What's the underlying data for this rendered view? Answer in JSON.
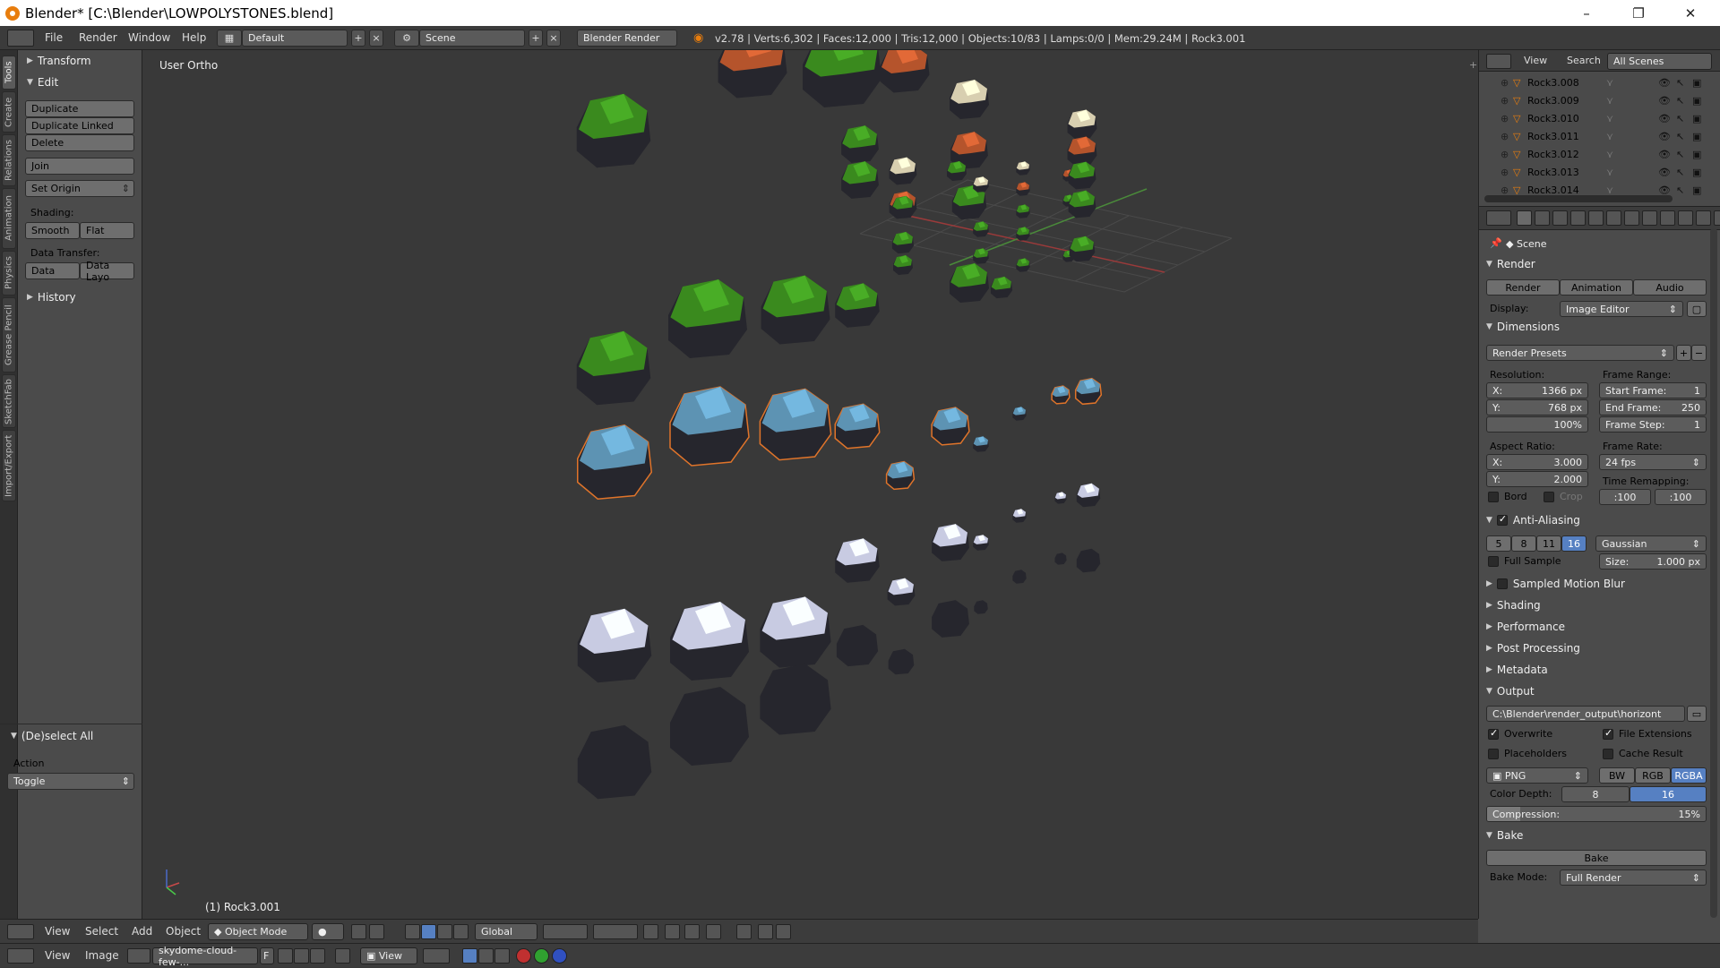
{
  "window": {
    "title": "Blender* [C:\\Blender\\LOWPOLYSTONES.blend]",
    "minimize": "–",
    "maximize": "❐",
    "close": "✕"
  },
  "info_bar": {
    "menus": [
      "File",
      "Render",
      "Window",
      "Help"
    ],
    "layout": "Default",
    "scene": "Scene",
    "engine": "Blender Render",
    "stats": "v2.78 | Verts:6,302 | Faces:12,000 | Tris:12,000 | Objects:10/83 | Lamps:0/0 | Mem:29.24M | Rock3.001"
  },
  "left_tabs": [
    "Tools",
    "Create",
    "Relations",
    "Animation",
    "Physics",
    "Grease Pencil",
    "SketchFab",
    "Import/Export"
  ],
  "tool_shelf": {
    "transform": "Transform",
    "edit": "Edit",
    "duplicate": "Duplicate",
    "duplicate_linked": "Duplicate Linked",
    "delete": "Delete",
    "join": "Join",
    "set_origin": "Set Origin",
    "shading_label": "Shading:",
    "smooth": "Smooth",
    "flat": "Flat",
    "data_transfer_label": "Data Transfer:",
    "data": "Data",
    "data_layo": "Data Layo",
    "history": "History",
    "deselect_all": "(De)select All",
    "action_label": "Action",
    "action_value": "Toggle"
  },
  "viewport": {
    "view_name": "User Ortho",
    "selected_object": "(1) Rock3.001",
    "axis_x": "x",
    "axis_y": "y",
    "axis_z": "z"
  },
  "outliner": {
    "view": "View",
    "search": "Search",
    "filter": "All Scenes",
    "rows": [
      "Rock3.008",
      "Rock3.009",
      "Rock3.010",
      "Rock3.011",
      "Rock3.012",
      "Rock3.013",
      "Rock3.014"
    ]
  },
  "properties": {
    "scene": "Scene",
    "render_section": "Render",
    "render_btn": "Render",
    "animation_btn": "Animation",
    "audio_btn": "Audio",
    "display_label": "Display:",
    "display_value": "Image Editor",
    "dimensions_section": "Dimensions",
    "render_presets": "Render Presets",
    "resolution_label": "Resolution:",
    "res_x_label": "X:",
    "res_x": "1366 px",
    "res_y_label": "Y:",
    "res_y": "768 px",
    "res_pct": "100%",
    "frame_range_label": "Frame Range:",
    "start_frame_label": "Start Frame:",
    "start_frame": "1",
    "end_frame_label": "End Frame:",
    "end_frame": "250",
    "frame_step_label": "Frame Step:",
    "frame_step": "1",
    "aspect_label": "Aspect Ratio:",
    "aspect_x_label": "X:",
    "aspect_x": "3.000",
    "aspect_y_label": "Y:",
    "aspect_y": "2.000",
    "frame_rate_label": "Frame Rate:",
    "frame_rate": "24 fps",
    "time_remap_label": "Time Remapping:",
    "remap_old": ":100",
    "remap_new": ":100",
    "bord": "Bord",
    "crop": "Crop",
    "aa_section": "Anti-Aliasing",
    "aa_samples": [
      "5",
      "8",
      "11",
      "16"
    ],
    "aa_filter": "Gaussian",
    "full_sample": "Full Sample",
    "size_label": "Size:",
    "size_value": "1.000 px",
    "motion_blur": "Sampled Motion Blur",
    "shading": "Shading",
    "performance": "Performance",
    "post_processing": "Post Processing",
    "metadata": "Metadata",
    "output_section": "Output",
    "output_path": "C:\\Blender\\render_output\\horizont",
    "overwrite": "Overwrite",
    "file_extensions": "File Extensions",
    "placeholders": "Placeholders",
    "cache_result": "Cache Result",
    "format": "PNG",
    "bw": "BW",
    "rgb": "RGB",
    "rgba": "RGBA",
    "color_depth_label": "Color Depth:",
    "depth_8": "8",
    "depth_16": "16",
    "compression_label": "Compression:",
    "compression_value": "15%",
    "compression_pct": 0.15,
    "bake_section": "Bake",
    "bake_btn": "Bake",
    "bake_mode_label": "Bake Mode:",
    "bake_mode": "Full Render"
  },
  "view3d_header": {
    "view": "View",
    "select": "Select",
    "add": "Add",
    "object": "Object",
    "mode": "Object Mode",
    "orientation": "Global"
  },
  "image_header": {
    "view": "View",
    "image": "Image",
    "image_name": "skydome-cloud-few-...",
    "fake_user": "F",
    "view2": "View"
  },
  "colors": {
    "accent": "#5680c2",
    "selection_outline": "#e0742a",
    "grass": "#3a8a1e",
    "clay": "#b5542c",
    "sand": "#d8cfb0",
    "blue_rock": "#5d93b3",
    "snow": "#c8cbe2",
    "dark_rock": "#26262d"
  }
}
